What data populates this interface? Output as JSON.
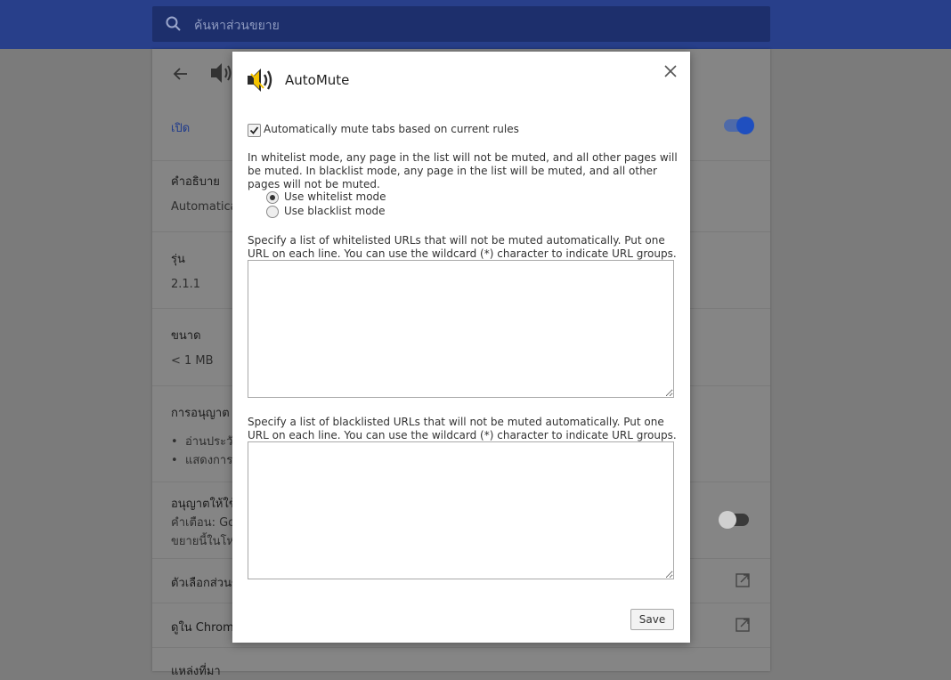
{
  "search": {
    "placeholder": "ค้นหาส่วนขยาย"
  },
  "background": {
    "enabled_label": "เปิด",
    "sections": [
      {
        "title": "คำอธิบาย",
        "value": "Automatica"
      },
      {
        "title": "รุ่น",
        "value": "2.1.1"
      },
      {
        "title": "ขนาด",
        "value": "< 1 MB"
      },
      {
        "title": "การอนุญาต",
        "items": [
          "อ่านประวั",
          "แสดงการ"
        ]
      },
      {
        "title": "อนุญาตให้ใช้",
        "lines": [
          "คำเตือน: Goo",
          "ขยายนี้ในโห"
        ]
      },
      {
        "title": "ตัวเลือกส่วนข"
      },
      {
        "title": "ดูใน Chrome"
      },
      {
        "title": "แหล่งที่มา"
      }
    ]
  },
  "dialog": {
    "title": "AutoMute",
    "auto_mute_label": "Automatically mute tabs based on current rules",
    "auto_mute_checked": true,
    "mode_description": "In whitelist mode, any page in the list will not be muted, and all other pages will be muted. In blacklist mode, any page in the list will be muted, and all other pages will not be muted.",
    "modes": [
      {
        "label": "Use whitelist mode",
        "selected": true
      },
      {
        "label": "Use blacklist mode",
        "selected": false
      }
    ],
    "whitelist_hint": "Specify a list of whitelisted URLs that will not be muted automatically. Put one URL on each line. You can use the wildcard (*) character to indicate URL groups.",
    "whitelist_value": "",
    "blacklist_hint": "Specify a list of blacklisted URLs that will not be muted automatically. Put one URL on each line. You can use the wildcard (*) character to indicate URL groups.",
    "blacklist_value": "",
    "save_label": "Save"
  },
  "colors": {
    "accent": "#1a73e8",
    "header": "#283f8a",
    "overlay": "#7b7b7b"
  }
}
